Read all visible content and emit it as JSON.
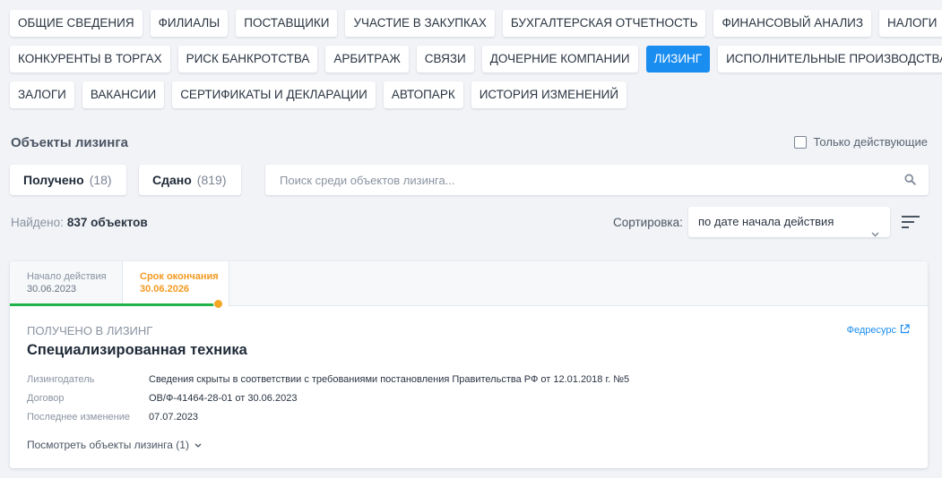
{
  "tabs": {
    "rows": [
      [
        "ОБЩИЕ СВЕДЕНИЯ",
        "ФИЛИАЛЫ",
        "ПОСТАВЩИКИ",
        "УЧАСТИЕ В ЗАКУПКАХ",
        "БУХГАЛТЕРСКАЯ ОТЧЕТНОСТЬ",
        "ФИНАНСОВЫЙ АНАЛИЗ",
        "НАЛОГИ"
      ],
      [
        "КОНКУРЕНТЫ В ТОРГАХ",
        "РИСК БАНКРОТСТВА",
        "АРБИТРАЖ",
        "СВЯЗИ",
        "ДОЧЕРНИЕ КОМПАНИИ",
        "ЛИЗИНГ",
        "ИСПОЛНИТЕЛЬНЫЕ ПРОИЗВОДСТВА"
      ],
      [
        "ЗАЛОГИ",
        "ВАКАНСИИ",
        "СЕРТИФИКАТЫ И ДЕКЛАРАЦИИ",
        "АВТОПАРК",
        "ИСТОРИЯ ИЗМЕНЕНИЙ"
      ]
    ],
    "active": "ЛИЗИНГ"
  },
  "section": {
    "title": "Объекты лизинга",
    "only_active_label": "Только действующие"
  },
  "direction": {
    "received_label": "Получено",
    "received_count": "(18)",
    "given_label": "Сдано",
    "given_count": "(819)"
  },
  "search": {
    "placeholder": "Поиск среди объектов лизинга..."
  },
  "results": {
    "found_label": "Найдено:",
    "found_value": "837 объектов"
  },
  "sort": {
    "label": "Сортировка:",
    "selected": "по дате начала действия"
  },
  "card": {
    "timeline": {
      "start_label": "Начало действия",
      "start_date": "30.06.2023",
      "end_label": "Срок окончания",
      "end_date": "30.06.2026"
    },
    "kind": "ПОЛУЧЕНО В ЛИЗИНГ",
    "source_link": "Федресурс",
    "title": "Специализированная техника",
    "details": {
      "lessor_label": "Лизингодатель",
      "lessor_value": "Сведения скрыты в соответствии с требованиями постановления Правительства РФ от 12.01.2018 г. №5",
      "contract_label": "Договор",
      "contract_value": "ОВ/Ф-41464-28-01 от 30.06.2023",
      "changed_label": "Последнее изменение",
      "changed_value": "07.07.2023"
    },
    "more_label": "Посмотреть объекты лизинга (1)"
  },
  "colors": {
    "accent": "#1a8df0",
    "progress": "#22b24c",
    "warning": "#f29a22",
    "background": "#f1f3f6"
  }
}
